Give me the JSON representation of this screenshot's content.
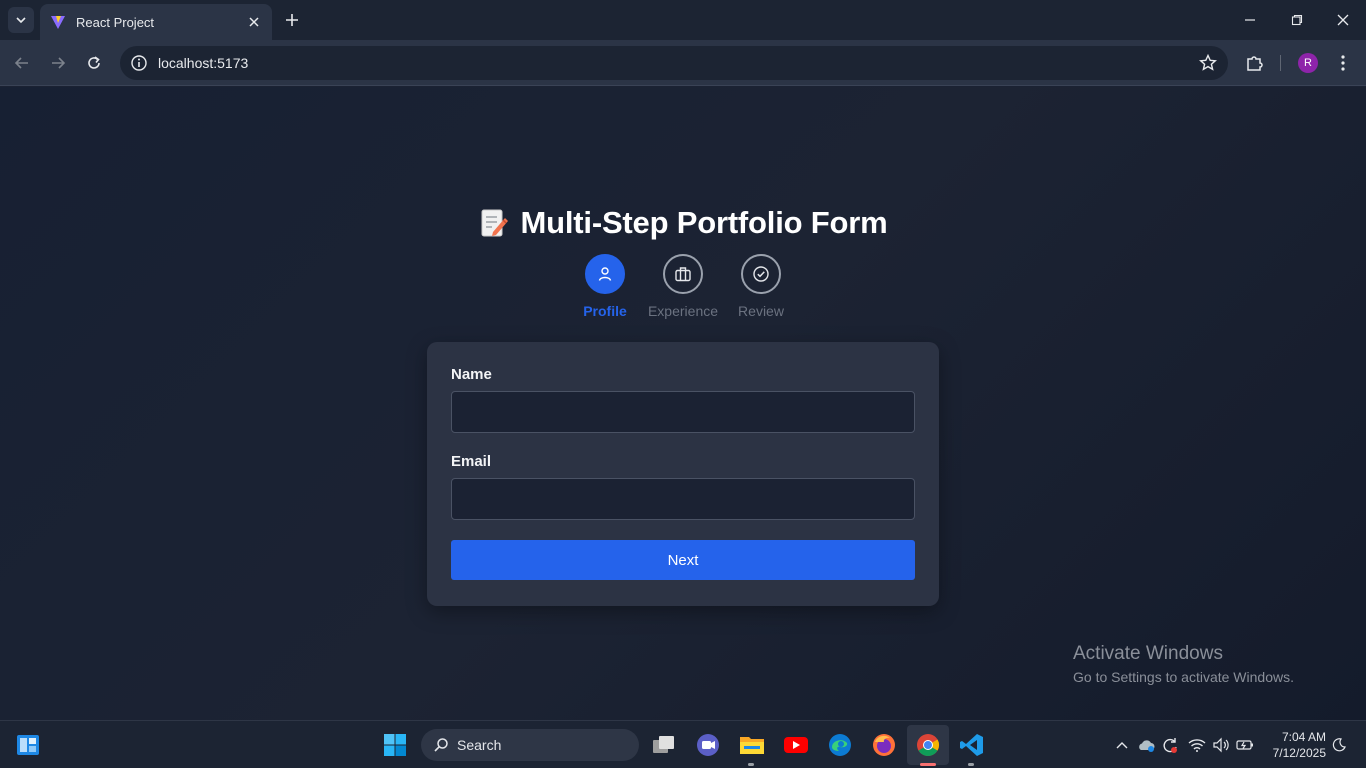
{
  "browser": {
    "tab_title": "React Project",
    "url": "localhost:5173",
    "profile_initial": "R"
  },
  "page": {
    "title": "Multi-Step Portfolio Form",
    "steps": [
      {
        "label": "Profile",
        "icon": "user-icon",
        "active": true
      },
      {
        "label": "Experience",
        "icon": "briefcase-icon",
        "active": false
      },
      {
        "label": "Review",
        "icon": "check-circle-icon",
        "active": false
      }
    ],
    "form": {
      "name_label": "Name",
      "name_value": "",
      "email_label": "Email",
      "email_value": "",
      "next_label": "Next"
    }
  },
  "watermark": {
    "title": "Activate Windows",
    "subtitle": "Go to Settings to activate Windows."
  },
  "taskbar": {
    "search_label": "Search",
    "time": "7:04 AM",
    "date": "7/12/2025",
    "accent": "#2563eb"
  }
}
